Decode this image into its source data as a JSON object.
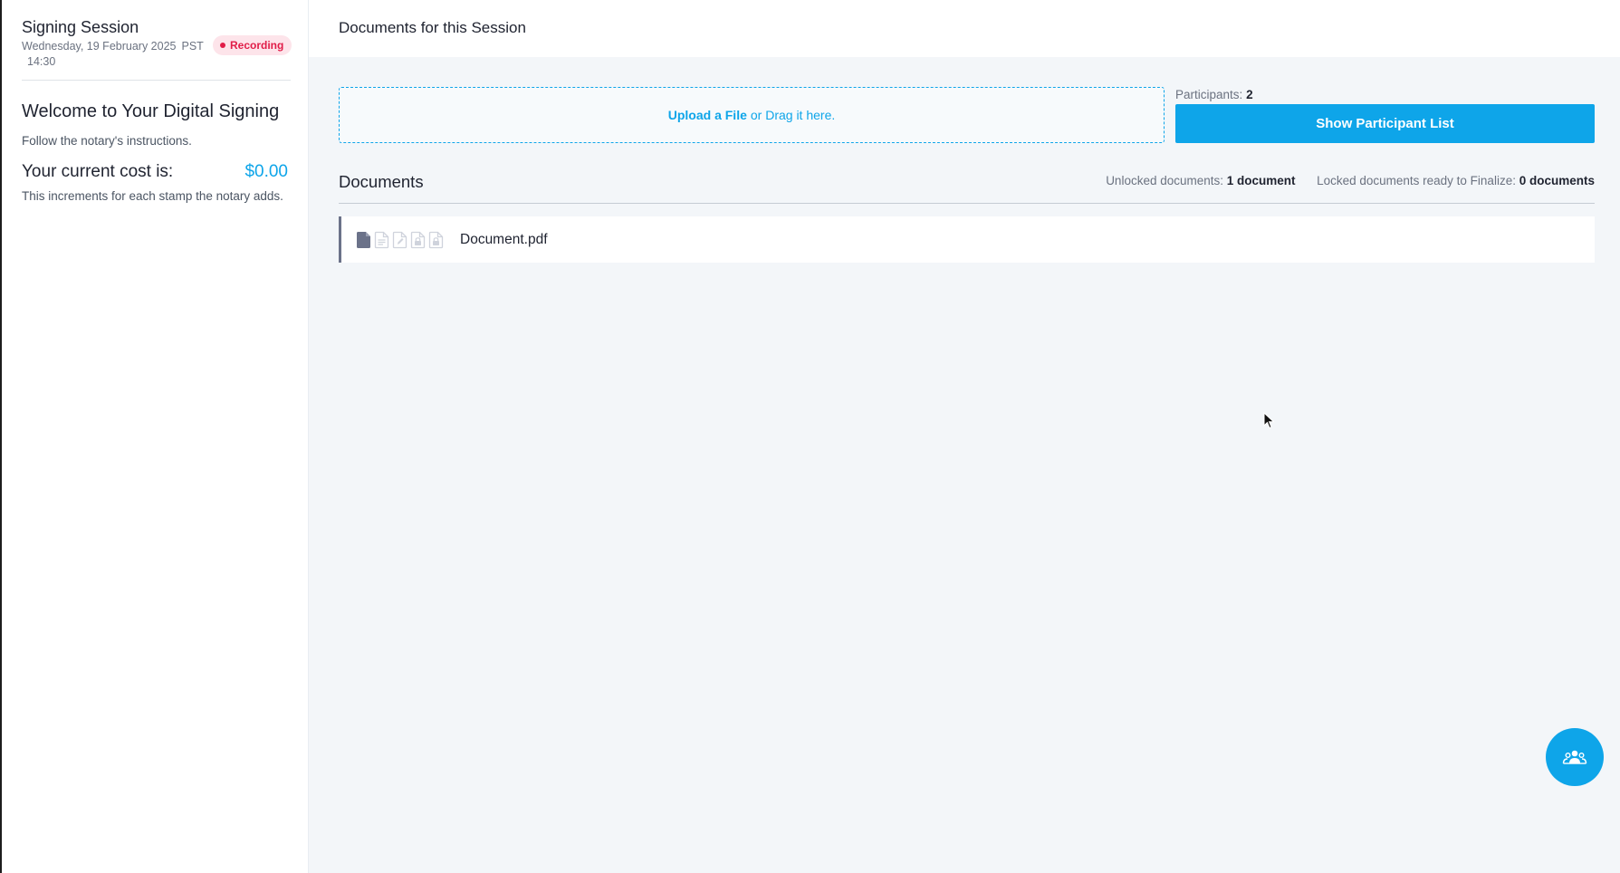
{
  "sidebar": {
    "title": "Signing Session",
    "date": "Wednesday, 19 February 2025",
    "timezone": "PST",
    "time": "14:30",
    "recording_label": "Recording",
    "welcome": "Welcome to Your Digital Signing",
    "instructions": "Follow the notary's instructions.",
    "cost_label": "Your current cost is:",
    "cost_value": "$0.00",
    "cost_note": "This increments for each stamp the notary adds."
  },
  "header": {
    "title": "Documents for this Session"
  },
  "upload": {
    "link_label": "Upload a File",
    "drag_text": "or Drag it here."
  },
  "participants": {
    "label": "Participants:",
    "count": "2",
    "button_label": "Show Participant List"
  },
  "documents": {
    "heading": "Documents",
    "unlocked_label": "Unlocked documents:",
    "unlocked_value": "1 document",
    "locked_label": "Locked documents ready to Finalize:",
    "locked_value": "0 documents",
    "items": [
      {
        "name": "Document.pdf",
        "status_icons": [
          "document-filled-icon",
          "document-lines-icon",
          "document-edit-icon",
          "document-lock-icon",
          "document-lock-final-icon"
        ]
      }
    ]
  },
  "colors": {
    "accent": "#0ea5e9",
    "recording": "#e11d48",
    "recording_bg": "#fde4ea",
    "main_bg": "#f3f6f9"
  },
  "fab": {
    "icon": "participants-icon"
  }
}
